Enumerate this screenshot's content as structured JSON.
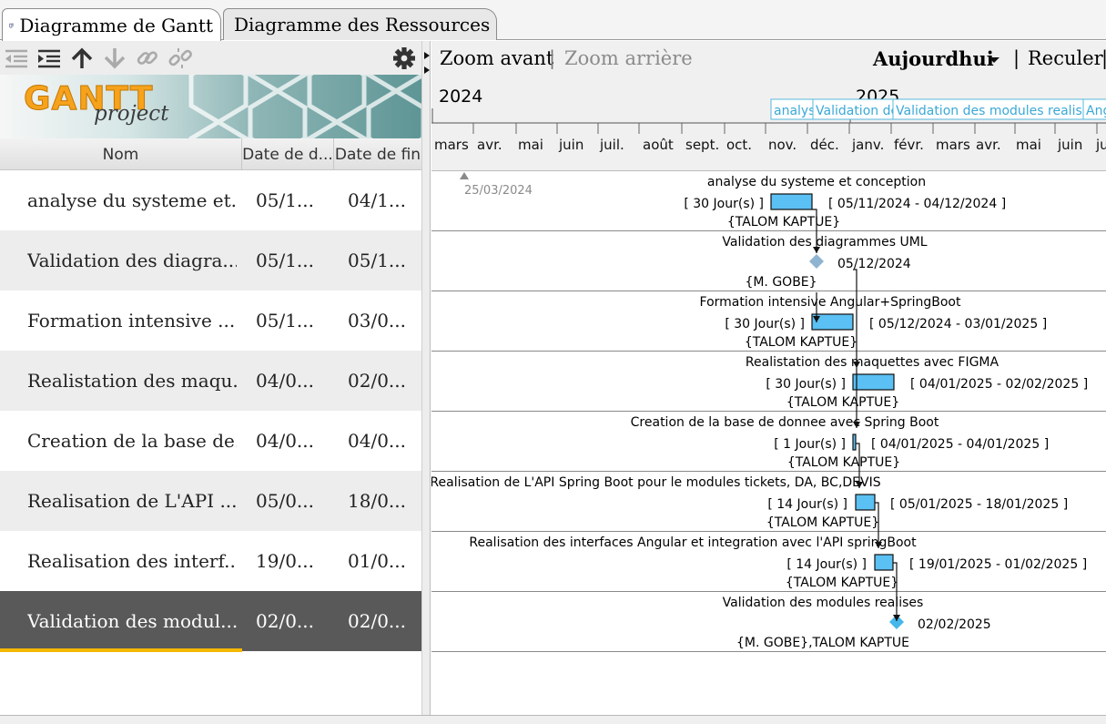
{
  "tabs": [
    {
      "label": "Diagramme de Gantt",
      "active": true
    },
    {
      "label": "Diagramme des Ressources",
      "active": false
    }
  ],
  "logo": {
    "main": "GANTT",
    "sub": "project"
  },
  "columns": {
    "name": "Nom",
    "start": "Date de d...",
    "end": "Date de fin"
  },
  "tasks": [
    {
      "name": "analyse du systeme et...",
      "start": "05/1...",
      "end": "04/1...",
      "selected": false
    },
    {
      "name": "Validation des diagra...",
      "start": "05/1...",
      "end": "05/1...",
      "selected": false
    },
    {
      "name": "Formation intensive ...",
      "start": "05/1...",
      "end": "03/0...",
      "selected": false
    },
    {
      "name": "Realistation des maqu...",
      "start": "04/0...",
      "end": "02/0...",
      "selected": false
    },
    {
      "name": "Creation de la base de...",
      "start": "04/0...",
      "end": "04/0...",
      "selected": false
    },
    {
      "name": "Realisation de L'API ...",
      "start": "05/0...",
      "end": "18/0...",
      "selected": false
    },
    {
      "name": "Realisation des interf...",
      "start": "19/0...",
      "end": "01/0...",
      "selected": false
    },
    {
      "name": "Validation des modul...",
      "start": "02/0...",
      "end": "02/0...",
      "selected": true
    }
  ],
  "toolbar_icons": [
    "outdent-icon",
    "indent-icon",
    "arrow-up-icon",
    "arrow-down-icon",
    "link-icon",
    "unlink-icon",
    "gear-icon"
  ],
  "zoom": {
    "in": "Zoom avant",
    "out": "Zoom arrière",
    "sep": "|"
  },
  "nav": {
    "today": "Aujourdhui",
    "back": "Reculer",
    "sep": "|"
  },
  "timeline": {
    "years": [
      "2024",
      "2025"
    ],
    "months": [
      "mars",
      "avr.",
      "mai",
      "juin",
      "juil.",
      "août",
      "sept.",
      "oct.",
      "nov.",
      "déc.",
      "janv.",
      "févr.",
      "mars",
      "avr.",
      "mai",
      "juin",
      "ju"
    ],
    "milestone_labels": [
      "analys",
      "Validation des",
      "Validation des modules realises",
      "Ang"
    ]
  },
  "project_start": "25/03/2024",
  "gantt_rows": [
    {
      "title": "analyse du systeme et conception",
      "duration": "[ 30 Jour(s) ]",
      "range": "[ 05/11/2024 - 04/12/2024 ]",
      "resource": "{TALOM KAPTUE}",
      "kind": "task"
    },
    {
      "title": "Validation des diagrammes UML",
      "duration": "",
      "range": "05/12/2024",
      "resource": "{M. GOBE}",
      "kind": "milestone"
    },
    {
      "title": "Formation intensive Angular+SpringBoot",
      "duration": "[ 30 Jour(s) ]",
      "range": "[ 05/12/2024 - 03/01/2025 ]",
      "resource": "{TALOM KAPTUE}",
      "kind": "task"
    },
    {
      "title": "Realistation des maquettes avec FIGMA",
      "duration": "[ 30 Jour(s) ]",
      "range": "[ 04/01/2025 - 02/02/2025 ]",
      "resource": "{TALOM KAPTUE}",
      "kind": "task"
    },
    {
      "title": "Creation de la base de donnee avec Spring Boot",
      "duration": "[ 1 Jour(s) ]",
      "range": "[ 04/01/2025 - 04/01/2025 ]",
      "resource": "{TALOM KAPTUE}",
      "kind": "task"
    },
    {
      "title": "Realisation de L'API Spring Boot pour le modules tickets, DA, BC,DEVIS",
      "duration": "[ 14 Jour(s) ]",
      "range": "[ 05/01/2025 - 18/01/2025 ]",
      "resource": "{TALOM KAPTUE}",
      "kind": "task"
    },
    {
      "title": "Realisation des interfaces Angular et integration avec l'API springBoot",
      "duration": "[ 14 Jour(s) ]",
      "range": "[ 19/01/2025 - 01/02/2025 ]",
      "resource": "{TALOM KAPTUE}",
      "kind": "task"
    },
    {
      "title": "Validation des modules realises",
      "duration": "",
      "range": "02/02/2025",
      "resource": "{M. GOBE},TALOM KAPTUE",
      "kind": "milestone"
    }
  ],
  "colors": {
    "bar": "#5bc0f3",
    "milestone_past": "#8fb4d2",
    "milestone_active": "#45b7ea",
    "selection": "#595959",
    "selection_accent": "#f5b800"
  }
}
